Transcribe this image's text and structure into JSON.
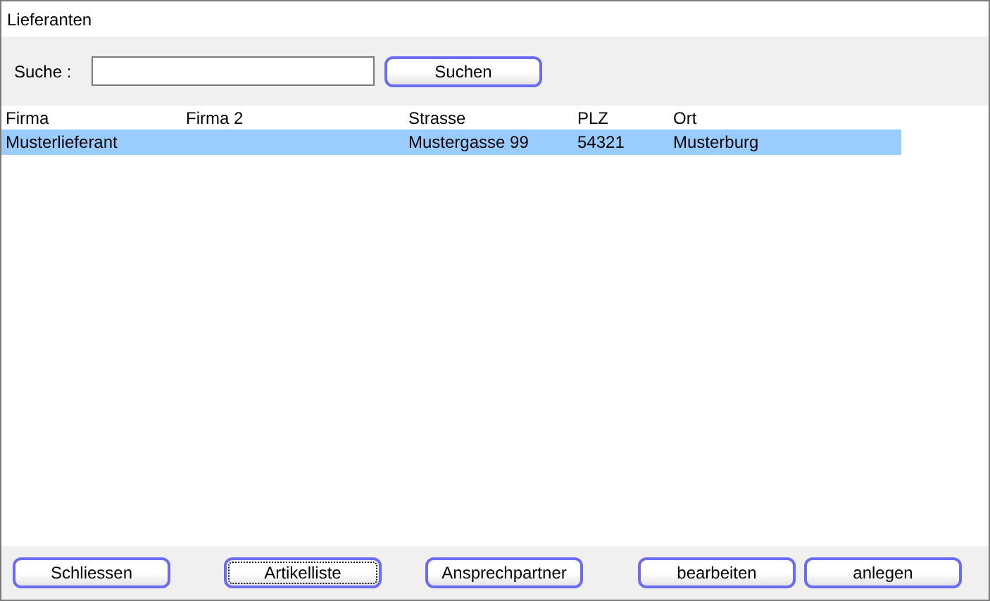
{
  "window": {
    "title": "Lieferanten"
  },
  "search": {
    "label": "Suche :",
    "button": "Suchen"
  },
  "table": {
    "columns": [
      "Firma",
      "Firma 2",
      "Strasse",
      "PLZ",
      "Ort"
    ],
    "rows": [
      {
        "cells": [
          "Musterlieferant",
          "",
          "Mustergasse 99",
          "54321",
          "Musterburg"
        ],
        "selected": true
      }
    ]
  },
  "buttons": [
    {
      "label": "Schliessen",
      "focused": false
    },
    {
      "label": "Artikelliste",
      "focused": true
    },
    {
      "label": "Ansprechpartner",
      "focused": false
    },
    {
      "label": "bearbeiten",
      "focused": false
    },
    {
      "label": "anlegen",
      "focused": false
    }
  ]
}
